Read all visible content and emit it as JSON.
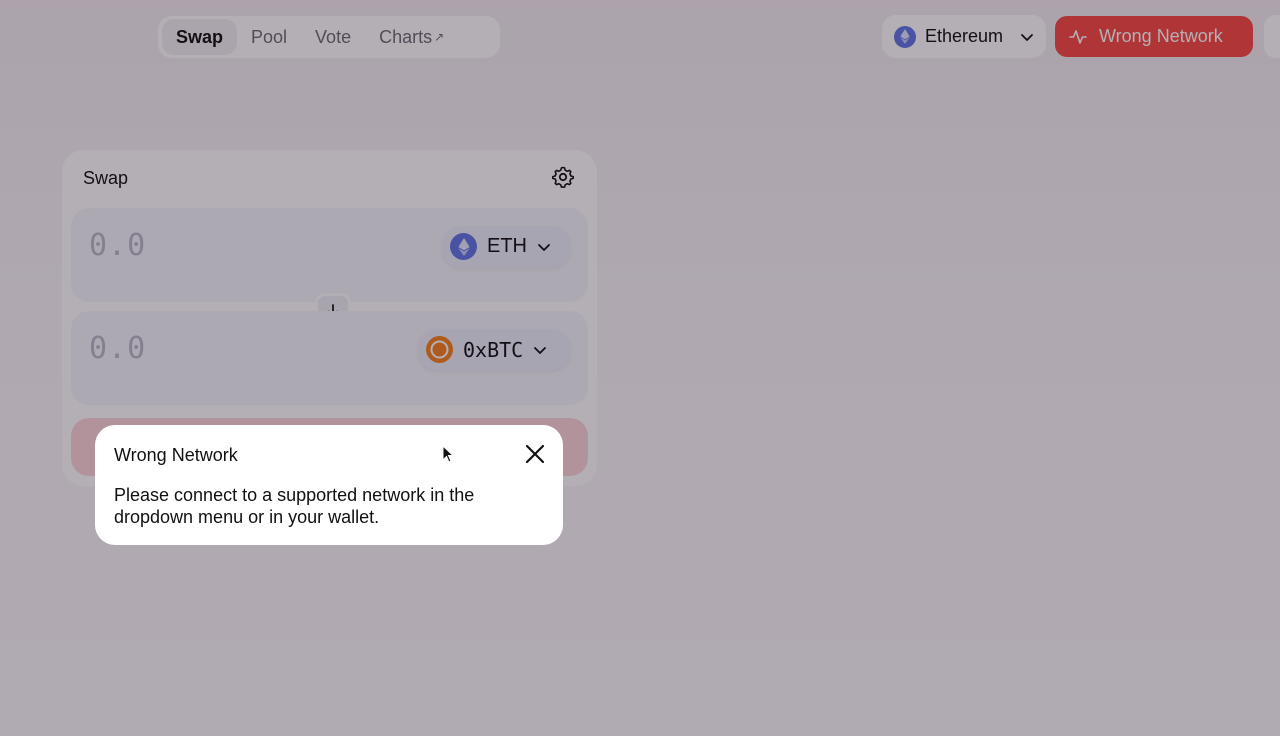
{
  "nav": {
    "tabs": [
      {
        "label": "Swap",
        "active": true
      },
      {
        "label": "Pool",
        "active": false
      },
      {
        "label": "Vote",
        "active": false
      },
      {
        "label": "Charts",
        "external_icon": "arrow-up-right-icon"
      }
    ],
    "network": {
      "label": "Ethereum",
      "icon": "ethereum-icon"
    },
    "wrong_network_button": {
      "label": "Wrong Network",
      "icon": "activity-icon",
      "color": "#fa4a43"
    }
  },
  "swap": {
    "title": "Swap",
    "settings_icon": "gear-icon",
    "input": {
      "amount_placeholder": "0.0",
      "token": "ETH",
      "token_color": "#6277e5"
    },
    "output": {
      "amount_placeholder": "0.0",
      "token": "0xBTC",
      "token_color": "#f7831e"
    },
    "switch_icon": "arrow-down-icon"
  },
  "modal": {
    "title": "Wrong Network",
    "body": "Please connect to a supported network in the dropdown menu or in your wallet.",
    "close_icon": "close-icon"
  }
}
